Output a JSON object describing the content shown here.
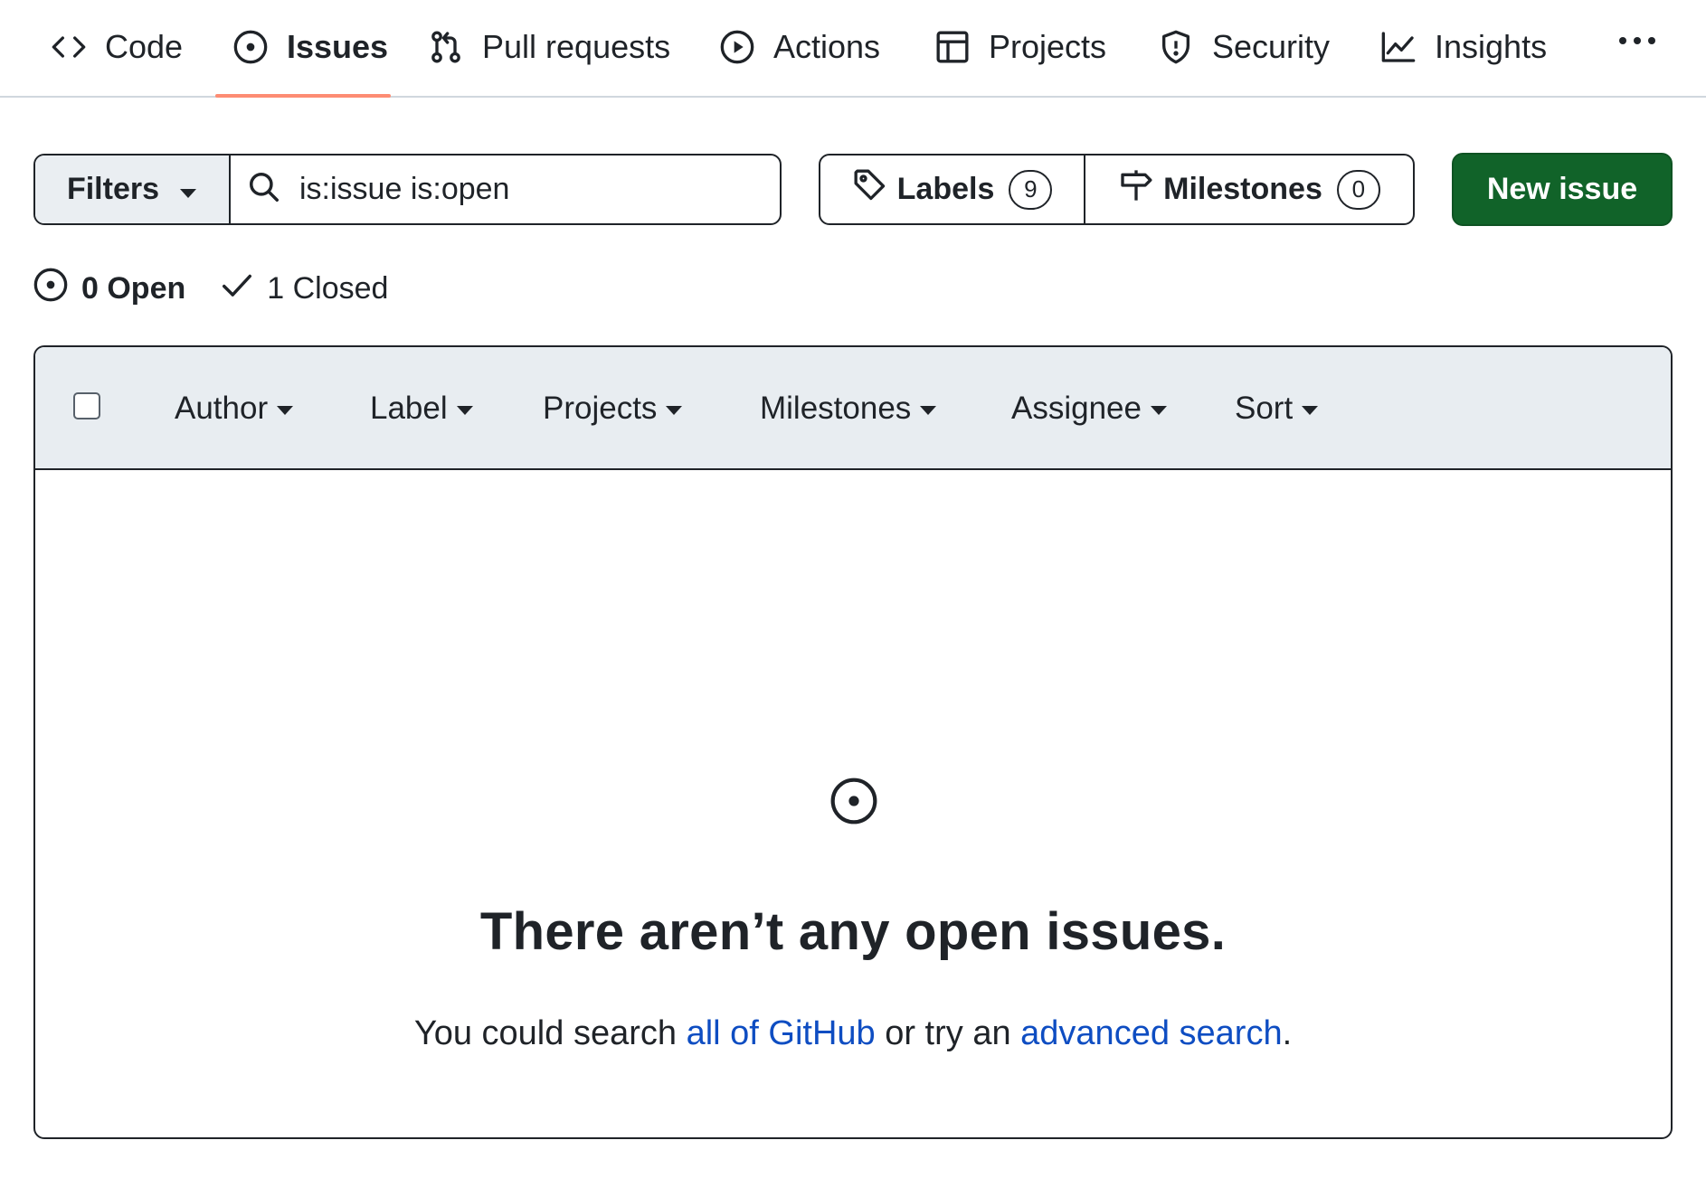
{
  "nav": {
    "tabs": [
      {
        "label": "Code",
        "icon": "code-icon"
      },
      {
        "label": "Issues",
        "icon": "issue-opened-icon",
        "selected": true
      },
      {
        "label": "Pull requests",
        "icon": "git-pull-request-icon"
      },
      {
        "label": "Actions",
        "icon": "play-icon"
      },
      {
        "label": "Projects",
        "icon": "table-icon"
      },
      {
        "label": "Security",
        "icon": "shield-icon"
      },
      {
        "label": "Insights",
        "icon": "graph-icon"
      }
    ],
    "more_icon": "kebab-horizontal-icon",
    "selected_underline_color": "#fd8c73"
  },
  "filter_bar": {
    "filters_label": "Filters",
    "search_value": "is:issue is:open",
    "labels_label": "Labels",
    "labels_count": "9",
    "milestones_label": "Milestones",
    "milestones_count": "0",
    "new_issue_label": "New issue",
    "new_issue_color": "#116329"
  },
  "state": {
    "open_label": "0 Open",
    "closed_label": "1 Closed"
  },
  "list_header": {
    "filters": [
      "Author",
      "Label",
      "Projects",
      "Milestones",
      "Assignee",
      "Sort"
    ]
  },
  "blankslate": {
    "title": "There aren’t any open issues.",
    "text_before": "You could search ",
    "link1": "all of GitHub",
    "text_middle": " or try an ",
    "link2": "advanced search",
    "text_after": ".",
    "link_color": "#0e4dc2"
  }
}
